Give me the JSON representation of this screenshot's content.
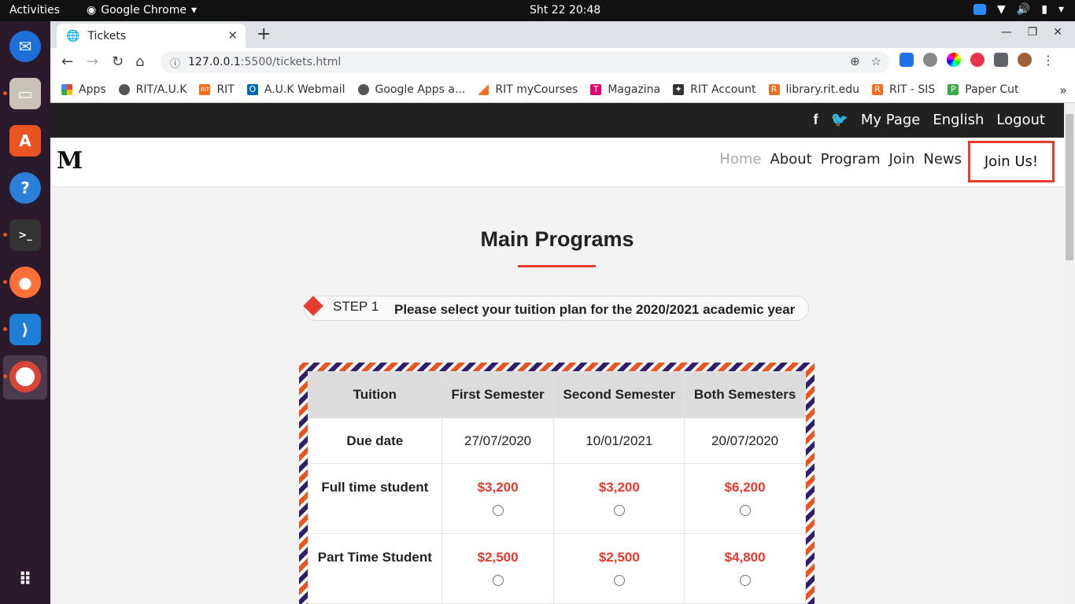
{
  "system": {
    "activities": "Activities",
    "app_name": "Google Chrome",
    "clock": "Sht 22  20:48"
  },
  "browser": {
    "tab_title": "Tickets",
    "url_host": "127.0.0.1",
    "url_path": ":5500/tickets.html",
    "bookmarks": [
      {
        "label": "Apps",
        "icon": "apps-grid-icon"
      },
      {
        "label": "RIT/A.U.K",
        "icon": "globe-icon"
      },
      {
        "label": "RIT",
        "icon": "rit-icon"
      },
      {
        "label": "A.U.K Webmail",
        "icon": "outlook-icon"
      },
      {
        "label": "Google Apps a...",
        "icon": "globe-icon"
      },
      {
        "label": "RIT myCourses",
        "icon": "mycourses-icon"
      },
      {
        "label": "Magazina",
        "icon": "telekom-icon"
      },
      {
        "label": "RIT Account",
        "icon": "rit-account-icon"
      },
      {
        "label": "library.rit.edu",
        "icon": "rit-r-icon"
      },
      {
        "label": "RIT - SIS",
        "icon": "rit-r-icon"
      },
      {
        "label": "Paper Cut",
        "icon": "papercut-icon"
      }
    ]
  },
  "site": {
    "top_links": [
      "My Page",
      "English",
      "Logout"
    ],
    "logo": "M",
    "menu": [
      "Home",
      "About",
      "Program",
      "Join",
      "News"
    ],
    "join_button": "Join Us!",
    "heading": "Main Programs",
    "step_label": "STEP 1",
    "step_text": "Please select your tuition plan for the 2020/2021 academic year",
    "table": {
      "headers": [
        "Tuition",
        "First Semester",
        "Second Semester",
        "Both Semesters"
      ],
      "due_label": "Due date",
      "due_dates": [
        "27/07/2020",
        "10/01/2021",
        "20/07/2020"
      ],
      "rows": [
        {
          "label": "Full time student",
          "prices": [
            "$3,200",
            "$3,200",
            "$6,200"
          ]
        },
        {
          "label": "Part Time Student",
          "prices": [
            "$2,500",
            "$2,500",
            "$4,800"
          ]
        }
      ]
    }
  },
  "colors": {
    "accent": "#e63b2e",
    "dark_bar": "#212121",
    "stripe_orange": "#e95420",
    "stripe_purple": "#2f1d6e"
  }
}
